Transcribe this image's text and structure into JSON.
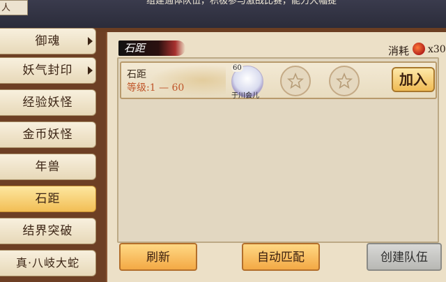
{
  "header": {
    "tab_label": "人",
    "marquee": "组建通体队伍，积极参与激战比赛，能力大幅提"
  },
  "sidebar": {
    "items": [
      {
        "label": "御魂",
        "arrow": true,
        "active": false
      },
      {
        "label": "妖气封印",
        "arrow": true,
        "active": false
      },
      {
        "label": "经验妖怪",
        "arrow": false,
        "active": false
      },
      {
        "label": "金币妖怪",
        "arrow": false,
        "active": false
      },
      {
        "label": "年兽",
        "arrow": false,
        "active": false
      },
      {
        "label": "石距",
        "arrow": false,
        "active": true
      },
      {
        "label": "结界突破",
        "arrow": false,
        "active": false
      },
      {
        "label": "真·八岐大蛇",
        "arrow": false,
        "active": false
      }
    ]
  },
  "panel": {
    "title": "石距",
    "cost_label": "消耗",
    "cost_icon": "stamina-orb-icon",
    "cost_value": "x30"
  },
  "team": {
    "name": "石距",
    "level_range": "等级:1 — 60",
    "member": {
      "level": "60",
      "name": "于川会儿"
    },
    "empty_slots": 2,
    "join_label": "加入"
  },
  "buttons": {
    "refresh": "刷新",
    "auto_match": "自动匹配",
    "create_team": "创建队伍"
  },
  "colors": {
    "accent_orange": "#f3a945",
    "active_tab": "#f2be55",
    "level_text": "#c0562a"
  }
}
